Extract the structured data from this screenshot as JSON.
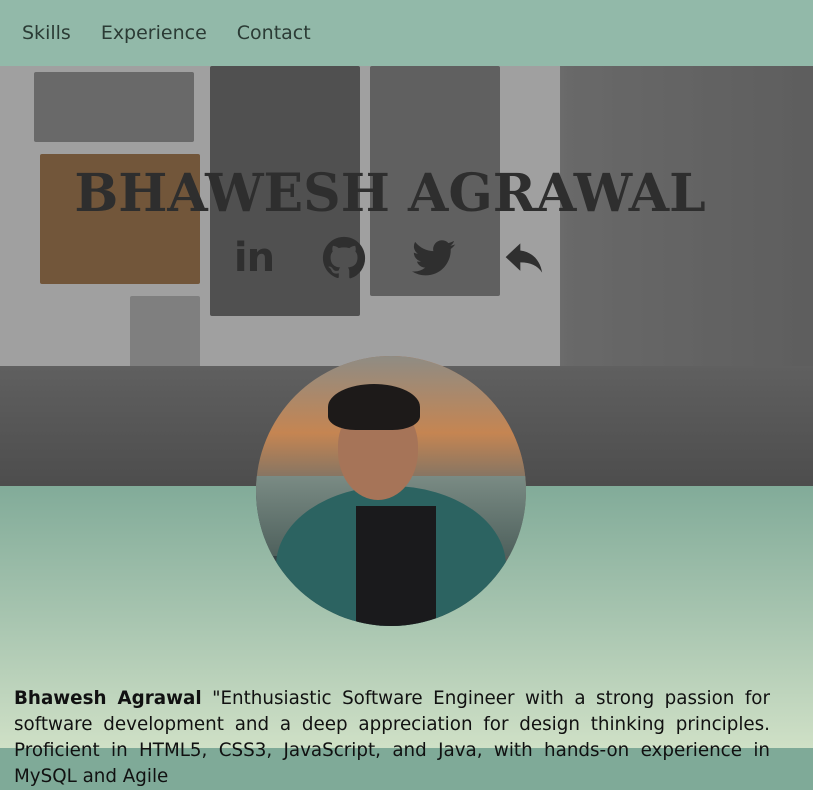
{
  "nav": {
    "items": [
      "Skills",
      "Experience",
      "Contact"
    ]
  },
  "hero": {
    "name": "BHAWESH AGRAWAL",
    "social": [
      {
        "icon": "linkedin-icon",
        "label": "in"
      },
      {
        "icon": "github-icon"
      },
      {
        "icon": "twitter-icon"
      },
      {
        "icon": "reply-arrow-icon"
      }
    ]
  },
  "profile": {
    "avatar_alt": "profile-photo"
  },
  "bio": {
    "name": "Bhawesh Agrawal",
    "text": " \"Enthusiastic Software Engineer with a strong passion for software development and a deep appreciation for design thinking principles. Proficient in HTML5, CSS3, JavaScript, and Java, with hands-on experience in MySQL and Agile"
  },
  "colors": {
    "nav_bg": "#92b9a9",
    "page_gradient_top": "#7faa98",
    "page_gradient_bottom": "#cfe0c6",
    "title_text": "#2e2e2e"
  }
}
